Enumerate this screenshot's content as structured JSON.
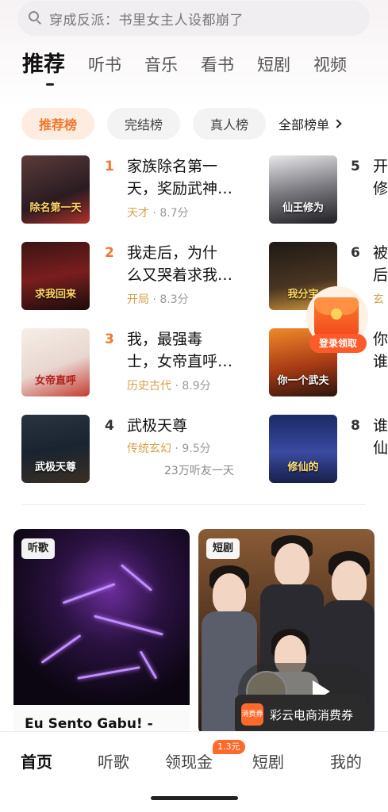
{
  "search": {
    "placeholder": "穿成反派：书里女主人设都崩了"
  },
  "category_tabs": [
    "推荐",
    "听书",
    "音乐",
    "看书",
    "短剧",
    "视频"
  ],
  "chips": {
    "items": [
      "推荐榜",
      "完结榜",
      "真人榜"
    ],
    "all_label": "全部榜单"
  },
  "ranking": {
    "left": [
      {
        "rank": "1",
        "title_line1": "家族除名第一",
        "title_line2": "天，奖励武神…",
        "genre": "天才",
        "score": " · 8.7分",
        "cover_text": "除名第一天"
      },
      {
        "rank": "2",
        "title_line1": "我走后，为什",
        "title_line2": "么又哭着求我…",
        "genre": "开局",
        "score": " · 8.3分",
        "cover_text": "求我回来"
      },
      {
        "rank": "3",
        "title_line1": "我，最强毒",
        "title_line2": "士，女帝直呼…",
        "genre": "历史古代",
        "score": " · 8.9分",
        "cover_text": "女帝直呼"
      },
      {
        "rank": "4",
        "title_line1": "武极天尊",
        "title_line2": "",
        "genre": "传统玄幻",
        "score": " · 9.5分",
        "listen": "23万听友一天",
        "cover_text": "武极天尊"
      }
    ],
    "right": [
      {
        "rank": "5",
        "title_line1": "开",
        "title_line2": "修",
        "cover_text": "仙王修为"
      },
      {
        "rank": "6",
        "title_line1": "被",
        "title_line2": "后",
        "extra": "玄",
        "cover_text": "我分宝"
      },
      {
        "rank": "7",
        "title_line1": "你",
        "title_line2": "谁",
        "cover_text": "你一个武夫"
      },
      {
        "rank": "8",
        "title_line1": "谁",
        "title_line2": "仙",
        "cover_text": "修仙的"
      }
    ]
  },
  "login_gift": {
    "label": "登录领取"
  },
  "cards": {
    "music": {
      "badge": "听歌",
      "caption": "Eu Sento Gabu! -"
    },
    "drama": {
      "badge": "短剧"
    }
  },
  "coupon": {
    "icon_text": "消费券",
    "text": "彩云电商消费券"
  },
  "bottom_nav": {
    "items": [
      "首页",
      "听歌",
      "领现金",
      "短剧",
      "我的"
    ],
    "badge": "1.3元"
  },
  "colors": {
    "accent": "#f0772e",
    "badge": "#ff6a2c"
  }
}
